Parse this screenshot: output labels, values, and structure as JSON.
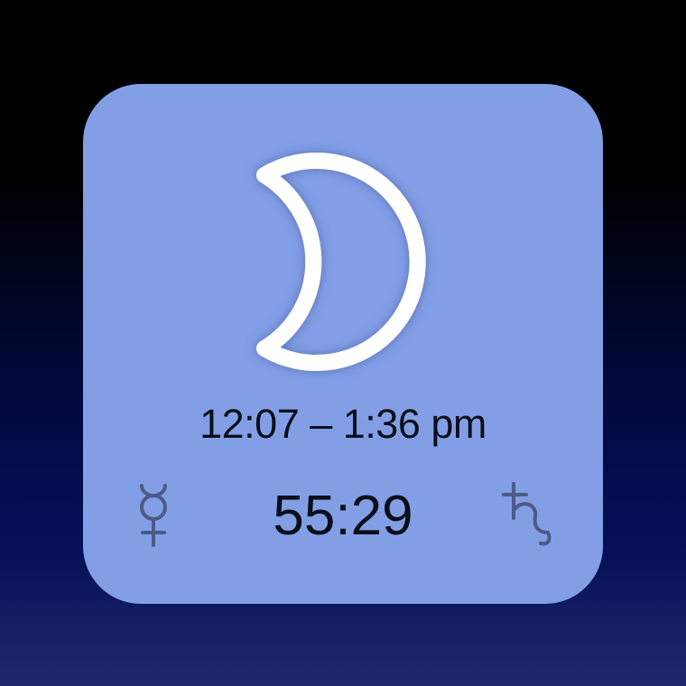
{
  "widget": {
    "background_color": "#829fe6",
    "moon_icon": "crescent-moon-icon",
    "time_range": "12:07 – 1:36 pm",
    "countdown": "55:29",
    "left_planet_icon": "mercury-symbol-icon",
    "right_planet_icon": "saturn-symbol-icon"
  }
}
